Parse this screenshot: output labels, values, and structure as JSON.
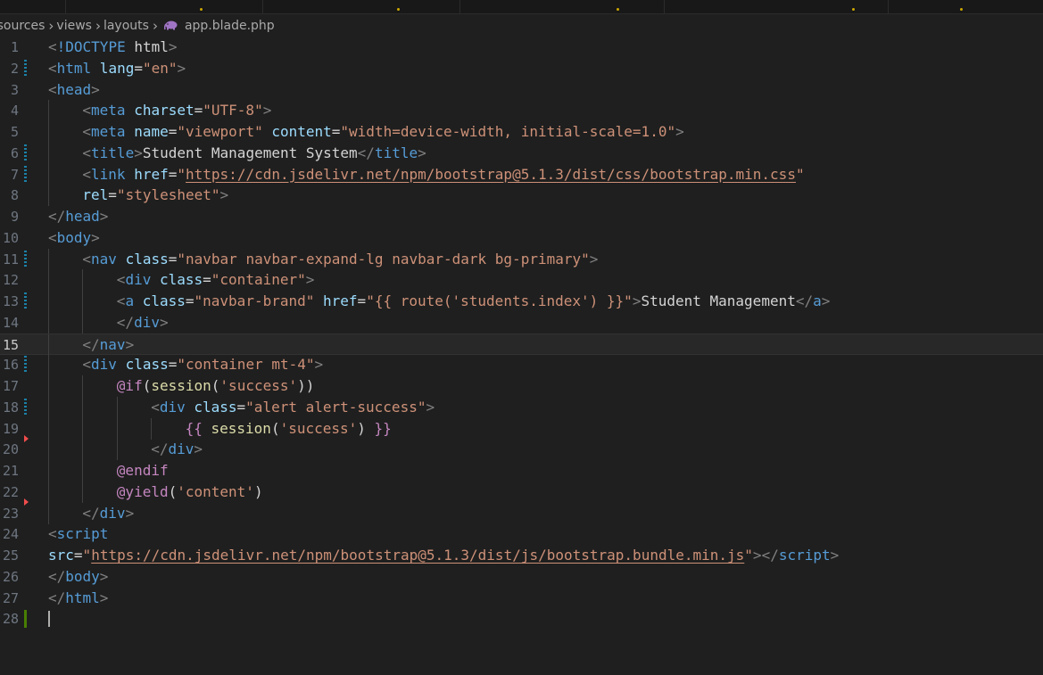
{
  "breadcrumb": {
    "items": [
      "esources",
      "views",
      "layouts",
      "app.blade.php"
    ],
    "file_icon": "php-elephant-icon"
  },
  "colors": {
    "background": "#1f1f1f",
    "tag": "#569cd6",
    "attribute": "#9cdcfe",
    "string": "#ce9178",
    "punctuation": "#808080",
    "text": "#d4d4d4",
    "modified_gutter": "#1b81a8",
    "added_gutter": "#487e02",
    "deleted_gutter": "#f14c4c"
  },
  "editor": {
    "current_line": 15,
    "lines": [
      {
        "n": "1",
        "indent": 0,
        "tokens": [
          [
            "p",
            "<"
          ],
          [
            "t",
            "!DOCTYPE"
          ],
          [
            "x",
            " html"
          ],
          [
            "p",
            ">"
          ]
        ]
      },
      {
        "n": "2",
        "indent": 0,
        "tokens": [
          [
            "p",
            "<"
          ],
          [
            "t",
            "html"
          ],
          [
            "a",
            " lang"
          ],
          [
            "x",
            "="
          ],
          [
            "s",
            "\"en\""
          ],
          [
            "p",
            ">"
          ]
        ]
      },
      {
        "n": "3",
        "indent": 0,
        "tokens": [
          [
            "p",
            "<"
          ],
          [
            "t",
            "head"
          ],
          [
            "p",
            ">"
          ]
        ]
      },
      {
        "n": "4",
        "indent": 1,
        "tokens": [
          [
            "p",
            "<"
          ],
          [
            "t",
            "meta"
          ],
          [
            "a",
            " charset"
          ],
          [
            "x",
            "="
          ],
          [
            "s",
            "\"UTF-8\""
          ],
          [
            "p",
            ">"
          ]
        ]
      },
      {
        "n": "5",
        "indent": 1,
        "tokens": [
          [
            "p",
            "<"
          ],
          [
            "t",
            "meta"
          ],
          [
            "a",
            " name"
          ],
          [
            "x",
            "="
          ],
          [
            "s",
            "\"viewport\""
          ],
          [
            "a",
            " content"
          ],
          [
            "x",
            "="
          ],
          [
            "s",
            "\"width=device-width, initial-scale=1.0\""
          ],
          [
            "p",
            ">"
          ]
        ]
      },
      {
        "n": "6",
        "indent": 1,
        "tokens": [
          [
            "p",
            "<"
          ],
          [
            "t",
            "title"
          ],
          [
            "p",
            ">"
          ],
          [
            "x",
            "Student Management System"
          ],
          [
            "p",
            "</"
          ],
          [
            "t",
            "title"
          ],
          [
            "p",
            ">"
          ]
        ]
      },
      {
        "n": "7",
        "indent": 1,
        "tokens": [
          [
            "p",
            "<"
          ],
          [
            "t",
            "link"
          ],
          [
            "a",
            " href"
          ],
          [
            "x",
            "="
          ],
          [
            "s",
            "\""
          ],
          [
            "u",
            "https://cdn.jsdelivr.net/npm/bootstrap@5.1.3/dist/css/bootstrap.min.css"
          ],
          [
            "s",
            "\""
          ]
        ]
      },
      {
        "n": "8",
        "indent": 1,
        "tokens": [
          [
            "a",
            "rel"
          ],
          [
            "x",
            "="
          ],
          [
            "s",
            "\"stylesheet\""
          ],
          [
            "p",
            ">"
          ]
        ]
      },
      {
        "n": "9",
        "indent": 0,
        "tokens": [
          [
            "p",
            "</"
          ],
          [
            "t",
            "head"
          ],
          [
            "p",
            ">"
          ]
        ]
      },
      {
        "n": "10",
        "indent": 0,
        "tokens": [
          [
            "p",
            "<"
          ],
          [
            "t",
            "body"
          ],
          [
            "p",
            ">"
          ]
        ]
      },
      {
        "n": "11",
        "indent": 1,
        "tokens": [
          [
            "p",
            "<"
          ],
          [
            "t",
            "nav"
          ],
          [
            "a",
            " class"
          ],
          [
            "x",
            "="
          ],
          [
            "s",
            "\"navbar navbar-expand-lg navbar-dark bg-primary\""
          ],
          [
            "p",
            ">"
          ]
        ]
      },
      {
        "n": "12",
        "indent": 2,
        "tokens": [
          [
            "p",
            "<"
          ],
          [
            "t",
            "div"
          ],
          [
            "a",
            " class"
          ],
          [
            "x",
            "="
          ],
          [
            "s",
            "\"container\""
          ],
          [
            "p",
            ">"
          ]
        ]
      },
      {
        "n": "13",
        "indent": 2,
        "tokens": [
          [
            "p",
            "<"
          ],
          [
            "t",
            "a"
          ],
          [
            "a",
            " class"
          ],
          [
            "x",
            "="
          ],
          [
            "s",
            "\"navbar-brand\""
          ],
          [
            "a",
            " href"
          ],
          [
            "x",
            "="
          ],
          [
            "s",
            "\"{{ route('students.index') }}\""
          ],
          [
            "p",
            ">"
          ],
          [
            "x",
            "Student Management"
          ],
          [
            "p",
            "</"
          ],
          [
            "t",
            "a"
          ],
          [
            "p",
            ">"
          ]
        ]
      },
      {
        "n": "14",
        "indent": 2,
        "tokens": [
          [
            "p",
            "</"
          ],
          [
            "t",
            "div"
          ],
          [
            "p",
            ">"
          ]
        ]
      },
      {
        "n": "15",
        "indent": 1,
        "tokens": [
          [
            "p",
            "</"
          ],
          [
            "t",
            "nav"
          ],
          [
            "p",
            ">"
          ]
        ]
      },
      {
        "n": "16",
        "indent": 1,
        "tokens": [
          [
            "p",
            "<"
          ],
          [
            "t",
            "div"
          ],
          [
            "a",
            " class"
          ],
          [
            "x",
            "="
          ],
          [
            "s",
            "\"container mt-4\""
          ],
          [
            "p",
            ">"
          ]
        ]
      },
      {
        "n": "17",
        "indent": 2,
        "tokens": [
          [
            "x",
            "@if(session('success'))"
          ]
        ]
      },
      {
        "n": "18",
        "indent": 3,
        "tokens": [
          [
            "p",
            "<"
          ],
          [
            "t",
            "div"
          ],
          [
            "a",
            " class"
          ],
          [
            "x",
            "="
          ],
          [
            "s",
            "\"alert alert-success\""
          ],
          [
            "p",
            ">"
          ]
        ]
      },
      {
        "n": "19",
        "indent": 4,
        "tokens": [
          [
            "x",
            "{{ session('success') }}"
          ]
        ]
      },
      {
        "n": "20",
        "indent": 3,
        "tokens": [
          [
            "p",
            "</"
          ],
          [
            "t",
            "div"
          ],
          [
            "p",
            ">"
          ]
        ]
      },
      {
        "n": "21",
        "indent": 2,
        "tokens": [
          [
            "x",
            "@endif"
          ]
        ]
      },
      {
        "n": "22",
        "indent": 2,
        "tokens": [
          [
            "x",
            "@yield('content')"
          ]
        ]
      },
      {
        "n": "23",
        "indent": 1,
        "tokens": [
          [
            "p",
            "</"
          ],
          [
            "t",
            "div"
          ],
          [
            "p",
            ">"
          ]
        ]
      },
      {
        "n": "24",
        "indent": 0,
        "tokens": [
          [
            "p",
            "<"
          ],
          [
            "t",
            "script"
          ]
        ]
      },
      {
        "n": "25",
        "indent": 0,
        "tokens": [
          [
            "a",
            "src"
          ],
          [
            "x",
            "="
          ],
          [
            "s",
            "\""
          ],
          [
            "u",
            "https://cdn.jsdelivr.net/npm/bootstrap@5.1.3/dist/js/bootstrap.bundle.min.js"
          ],
          [
            "s",
            "\""
          ],
          [
            "p",
            ">"
          ],
          [
            "p",
            "</"
          ],
          [
            "t",
            "script"
          ],
          [
            "p",
            ">"
          ]
        ]
      },
      {
        "n": "26",
        "indent": 0,
        "tokens": [
          [
            "p",
            "</"
          ],
          [
            "t",
            "body"
          ],
          [
            "p",
            ">"
          ]
        ]
      },
      {
        "n": "27",
        "indent": 0,
        "tokens": [
          [
            "p",
            "</"
          ],
          [
            "t",
            "html"
          ],
          [
            "p",
            ">"
          ]
        ]
      },
      {
        "n": "28",
        "indent": 0,
        "tokens": []
      }
    ]
  }
}
